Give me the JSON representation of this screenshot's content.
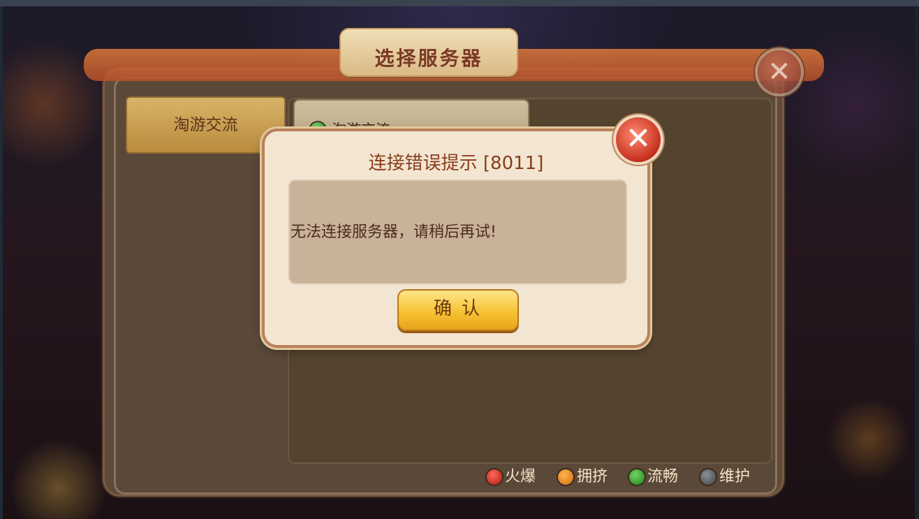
{
  "dialog": {
    "title": "选择服务器",
    "close_icon": "close-icon"
  },
  "sidebar": {
    "tabs": [
      {
        "label": "淘游交流"
      }
    ]
  },
  "server_list": {
    "items": [
      {
        "label": "淘游交流",
        "status_color": "#3ea52e"
      }
    ]
  },
  "legend": [
    {
      "label": "火爆",
      "color": "#d3261c"
    },
    {
      "label": "拥挤",
      "color": "#e98a1e"
    },
    {
      "label": "流畅",
      "color": "#2f9a25"
    },
    {
      "label": "维护",
      "color": "#555a5f"
    }
  ],
  "error_dialog": {
    "title": "连接错误提示 [8011]",
    "message": "无法连接服务器，请稍后再试!",
    "confirm_label": "确认",
    "close_icon": "close-icon"
  }
}
